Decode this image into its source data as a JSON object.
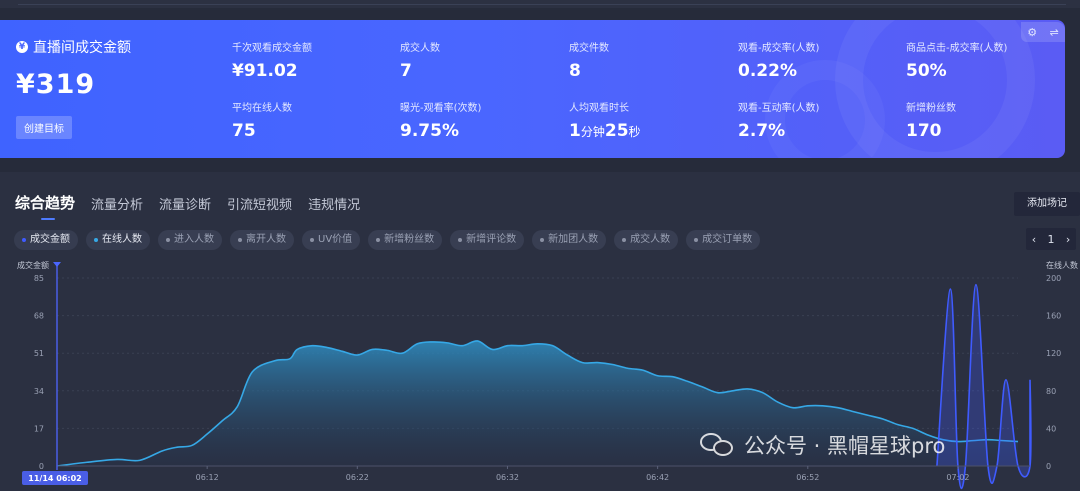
{
  "banner": {
    "title": "直播间成交金额",
    "amount": "¥319",
    "target_button": "创建目标",
    "metrics_row1": [
      {
        "label": "千次观看成交金额",
        "value": "¥91.02"
      },
      {
        "label": "成交人数",
        "value": "7"
      },
      {
        "label": "成交件数",
        "value": "8"
      },
      {
        "label": "观看-成交率(人数)",
        "value": "0.22%"
      },
      {
        "label": "商品点击-成交率(人数)",
        "value": "50%"
      }
    ],
    "metrics_row2": [
      {
        "label": "平均在线人数",
        "value": "75"
      },
      {
        "label": "曝光-观看率(次数)",
        "value": "9.75%"
      },
      {
        "label": "人均观看时长",
        "value_a": "1",
        "unit_a": "分钟",
        "value_b": "25",
        "unit_b": "秒"
      },
      {
        "label": "观看-互动率(人数)",
        "value": "2.7%"
      },
      {
        "label": "新增粉丝数",
        "value": "170"
      }
    ],
    "tool_icons": [
      "gear-icon",
      "swap-icon"
    ]
  },
  "tabs": [
    "综合趋势",
    "流量分析",
    "流量诊断",
    "引流短视频",
    "违规情况"
  ],
  "add_marker_button": "添加场记",
  "chips": [
    "成交金额",
    "在线人数",
    "进入人数",
    "离开人数",
    "UV价值",
    "新增粉丝数",
    "新增评论数",
    "新加团人数",
    "成交人数",
    "成交订单数"
  ],
  "pager": {
    "page": "1"
  },
  "watermark": "公众号 · 黑帽星球pro",
  "colors": {
    "area_line": "#36a8e6",
    "sales_line": "#3f5bff",
    "banner": "#4a66ff",
    "start_tag": "#4a5ee6"
  },
  "chart_data": {
    "type": "area",
    "left_axis": {
      "label": "成交金额",
      "ticks": [
        "85",
        "68",
        "51",
        "34",
        "17",
        "0"
      ],
      "range": [
        0,
        85
      ]
    },
    "right_axis": {
      "label": "在线人数",
      "ticks": [
        "200",
        "160",
        "120",
        "80",
        "40",
        "0"
      ],
      "range": [
        0,
        200
      ]
    },
    "x_ticks": [
      "06:12",
      "06:22",
      "06:32",
      "06:42",
      "06:52",
      "07:02"
    ],
    "x_range_minutes": [
      0,
      64
    ],
    "start_label": "11/14 06:02",
    "series": [
      {
        "name": "在线人数",
        "axis": "right",
        "x_minutes": [
          0,
          2,
          4,
          5.5,
          7,
          8,
          9,
          10,
          11,
          12,
          13,
          14.5,
          15.5,
          16,
          17,
          18,
          19,
          20,
          21,
          22,
          23,
          24,
          25,
          26,
          27,
          28,
          29,
          30,
          31,
          32,
          33,
          34,
          35,
          36,
          37,
          38,
          39,
          40,
          41,
          42,
          43,
          44,
          45,
          46,
          47,
          48,
          49,
          50,
          51,
          52,
          53,
          54,
          55,
          56,
          57,
          58,
          59,
          60,
          61,
          62,
          63,
          64
        ],
        "values": [
          0,
          4,
          7,
          6,
          16,
          20,
          22,
          34,
          48,
          63,
          100,
          112,
          114,
          124,
          128,
          126,
          122,
          118,
          124,
          123,
          120,
          130,
          132,
          131,
          128,
          133,
          124,
          128,
          128,
          130,
          128,
          118,
          110,
          110,
          108,
          104,
          102,
          96,
          95,
          90,
          84,
          78,
          80,
          82,
          78,
          68,
          62,
          64,
          64,
          62,
          58,
          54,
          50,
          44,
          40,
          33,
          28,
          26,
          27,
          28,
          27,
          26
        ]
      },
      {
        "name": "成交金额",
        "axis": "left",
        "x_minutes": [
          58.6,
          59.5,
          60,
          60.5,
          61.2,
          62,
          62.6,
          63.2,
          64,
          64.8,
          65.4,
          66.2
        ],
        "values": [
          0,
          80,
          0,
          0,
          82,
          0,
          0,
          39,
          0,
          0,
          39,
          0
        ]
      }
    ]
  }
}
